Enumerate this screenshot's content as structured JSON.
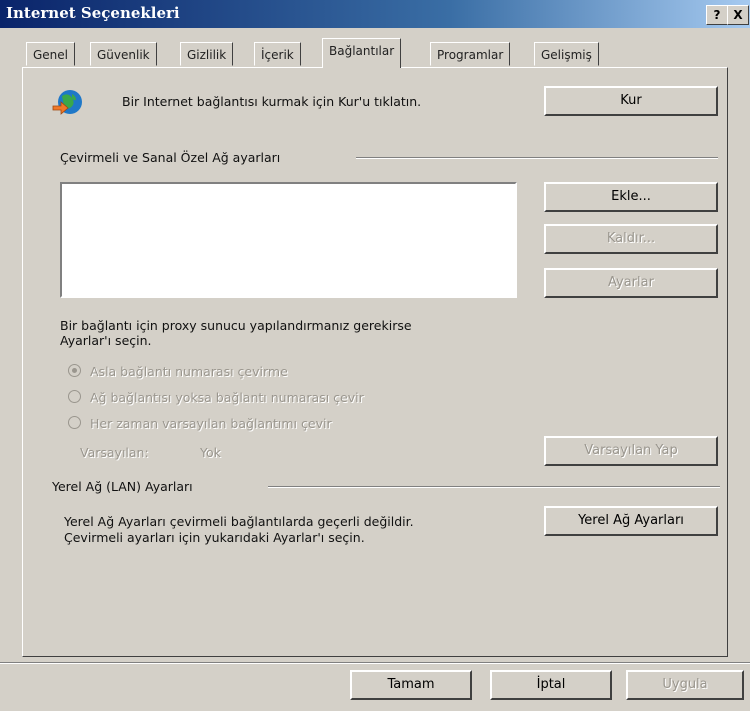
{
  "window": {
    "title": "Internet Seçenekleri",
    "help_btn": "?",
    "close_btn": "X"
  },
  "tabs": [
    "Genel",
    "Güvenlik",
    "Gizlilik",
    "İçerik",
    "Bağlantılar",
    "Programlar",
    "Gelişmiş"
  ],
  "active_tab": "Bağlantılar",
  "setup": {
    "text": "Bir Internet bağlantısı kurmak için Kur'u tıklatın.",
    "button": "Kur",
    "icon": "globe-network-icon"
  },
  "dialup": {
    "group_label": "Çevirmeli ve Sanal Özel Ağ ayarları",
    "add_button": "Ekle...",
    "remove_button": "Kaldır...",
    "settings_button": "Ayarlar",
    "proxy_hint_1": "Bir bağlantı için proxy sunucu yapılandırmanız gerekirse",
    "proxy_hint_2": "Ayarlar'ı seçin.",
    "radio_never": "Asla bağlantı numarası çevirme",
    "radio_when_no_network": "Ağ bağlantısı yoksa bağlantı numarası çevir",
    "radio_always": "Her zaman varsayılan bağlantımı çevir",
    "radio_selected": "radio_never",
    "default_label": "Varsayılan:",
    "default_value": "Yok",
    "set_default_button": "Varsayılan Yap"
  },
  "lan": {
    "group_label": "Yerel Ağ (LAN) Ayarları",
    "text_1": "Yerel Ağ Ayarları çevirmeli bağlantılarda geçerli değildir.",
    "text_2": "Çevirmeli ayarları için yukarıdaki Ayarlar'ı seçin.",
    "button": "Yerel Ağ Ayarları"
  },
  "footer": {
    "ok": "Tamam",
    "cancel": "İptal",
    "apply": "Uygula"
  }
}
